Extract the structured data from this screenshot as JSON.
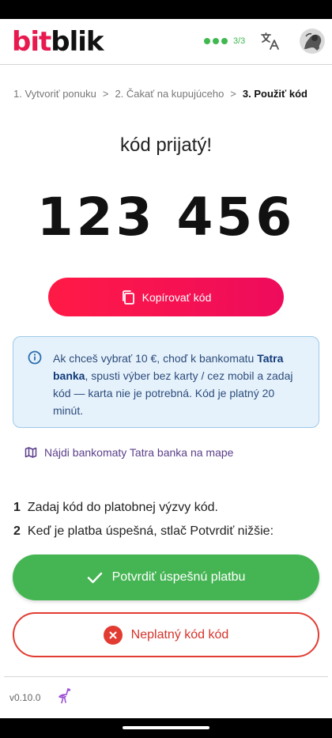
{
  "header": {
    "logo_bit": "bit",
    "logo_blik": "blik",
    "progress_text": "3/3",
    "progress_steps_done": 3,
    "accent_color": "#e8194f",
    "success_color": "#3fb84e"
  },
  "breadcrumb": {
    "step1": "1. Vytvoriť ponuku",
    "sep1": ">",
    "step2": "2. Čakať na kupujúceho",
    "sep2": ">",
    "step3": "3. Použiť kód"
  },
  "main": {
    "received_title": "kód prijatý!",
    "code": "123 456",
    "copy_label": "Kopírovať kód"
  },
  "info": {
    "text_before": "Ak chceš vybrať 10 €, choď k bankomatu ",
    "bank_name": "Tatra banka",
    "text_after": ", spusti výber bez karty / cez mobil a zadaj kód — karta nie je potrebná. Kód je platný 20 minút."
  },
  "map_link": {
    "label": "Nájdi bankomaty Tatra banka na mape"
  },
  "steps": [
    {
      "num": "1",
      "text": "Zadaj kód do platobnej výzvy kód."
    },
    {
      "num": "2",
      "text": "Keď je platba úspešná, stlač Potvrdiť nižšie:"
    }
  ],
  "actions": {
    "confirm_label": "Potvrdiť úspešnú platbu",
    "invalid_label": "Neplatný kód kód"
  },
  "footer": {
    "version": "v0.10.0"
  },
  "icons": {
    "translate": "translate-icon",
    "copy": "copy-icon",
    "info": "info-icon",
    "map": "map-icon",
    "check": "check-icon",
    "close": "close-icon",
    "ostrich": "ostrich-icon"
  }
}
